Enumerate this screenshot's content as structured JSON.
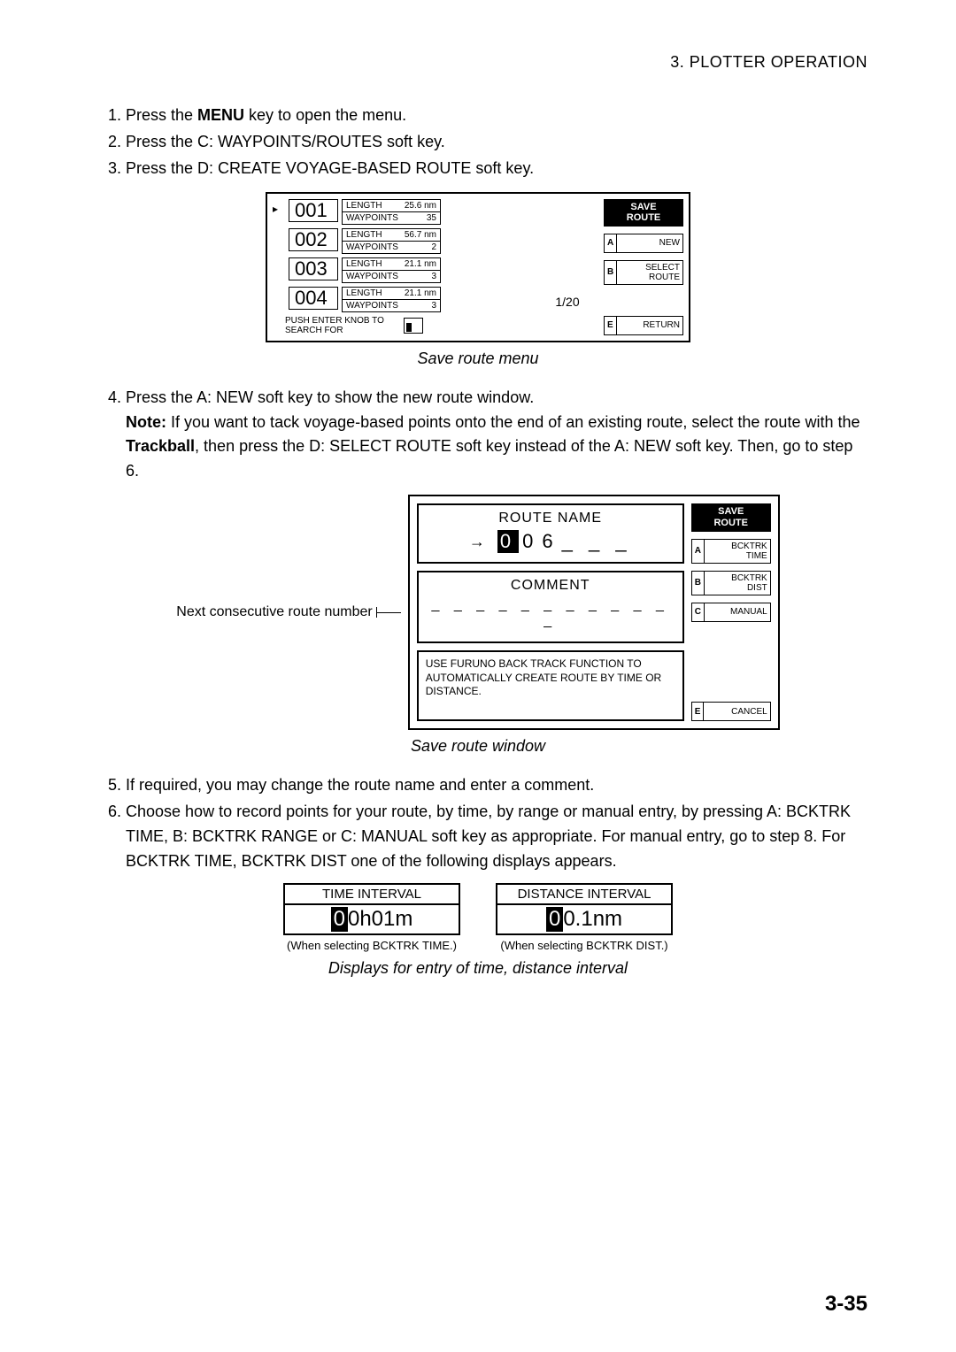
{
  "header": {
    "section": "3.  PLOTTER  OPERATION"
  },
  "steps": {
    "s1_a": "Press the ",
    "s1_b": "MENU",
    "s1_c": " key to open the menu.",
    "s2": "Press the C: WAYPOINTS/ROUTES soft key.",
    "s3": "Press the D: CREATE VOYAGE-BASED ROUTE soft key.",
    "s4": "Press the A: NEW soft key to show the new route window.",
    "note_a": "Note:",
    "note_b": " If you want to tack voyage-based points onto the end of an existing route, select the route with the ",
    "note_c": "Trackball",
    "note_d": ", then press the D: SELECT ROUTE soft key instead of the A: NEW soft key. Then, go to step 6.",
    "s5": "If required, you may change the route name and enter a comment.",
    "s6": "Choose how to record points for your route, by time, by range or manual entry, by pressing A: BCKTRK TIME, B: BCKTRK RANGE or C: MANUAL soft key as appropriate. For manual entry, go to step 8. For BCKTRK TIME, BCKTRK DIST one of the following displays appears."
  },
  "fig1": {
    "entries": [
      {
        "num": "001",
        "len_lbl": "LENGTH",
        "len_val": "25.6 nm",
        "wp_lbl": "WAYPOINTS",
        "wp_val": "35",
        "sel": "▸"
      },
      {
        "num": "002",
        "len_lbl": "LENGTH",
        "len_val": "56.7 nm",
        "wp_lbl": "WAYPOINTS",
        "wp_val": "2",
        "sel": ""
      },
      {
        "num": "003",
        "len_lbl": "LENGTH",
        "len_val": "21.1 nm",
        "wp_lbl": "WAYPOINTS",
        "wp_val": "3",
        "sel": ""
      },
      {
        "num": "004",
        "len_lbl": "LENGTH",
        "len_val": "21.1 nm",
        "wp_lbl": "WAYPOINTS",
        "wp_val": "3",
        "sel": ""
      }
    ],
    "search": "PUSH ENTER KNOB TO SEARCH FOR",
    "page": "1/20",
    "title": "SAVE ROUTE",
    "keys": {
      "a_k": "A",
      "a_t": "NEW",
      "b_k": "B",
      "b_t1": "SELECT",
      "b_t2": "ROUTE",
      "e_k": "E",
      "e_t": "RETURN"
    },
    "caption": "Save route menu"
  },
  "fig2": {
    "annot": "Next consecutive route number",
    "route_name_lbl": "ROUTE NAME",
    "route_name_digits": [
      "0",
      "0",
      "6"
    ],
    "route_name_blanks": "_ _ _",
    "comment_lbl": "COMMENT",
    "comment_blanks": "_ _ _ _ _ _ _ _ _ _ _ _",
    "info": "USE FURUNO BACK TRACK FUNCTION TO AUTOMATICALLY CREATE ROUTE BY TIME OR DISTANCE.",
    "title": "SAVE ROUTE",
    "keys": {
      "a_k": "A",
      "a_t1": "BCKTRK",
      "a_t2": "TIME",
      "b_k": "B",
      "b_t1": "BCKTRK",
      "b_t2": "DIST",
      "c_k": "C",
      "c_t": "MANUAL",
      "e_k": "E",
      "e_t": "CANCEL"
    },
    "caption": "Save route window"
  },
  "fig3": {
    "time_lbl": "TIME INTERVAL",
    "time_val_cursor": "0",
    "time_val_rest": "0h01m",
    "time_note": "(When selecting BCKTRK TIME.)",
    "dist_lbl": "DISTANCE INTERVAL",
    "dist_val_cursor": "0",
    "dist_val_rest": "0.1nm",
    "dist_note": "(When selecting BCKTRK DIST.)",
    "caption": "Displays for entry of time, distance interval"
  },
  "pagenum": "3-35"
}
